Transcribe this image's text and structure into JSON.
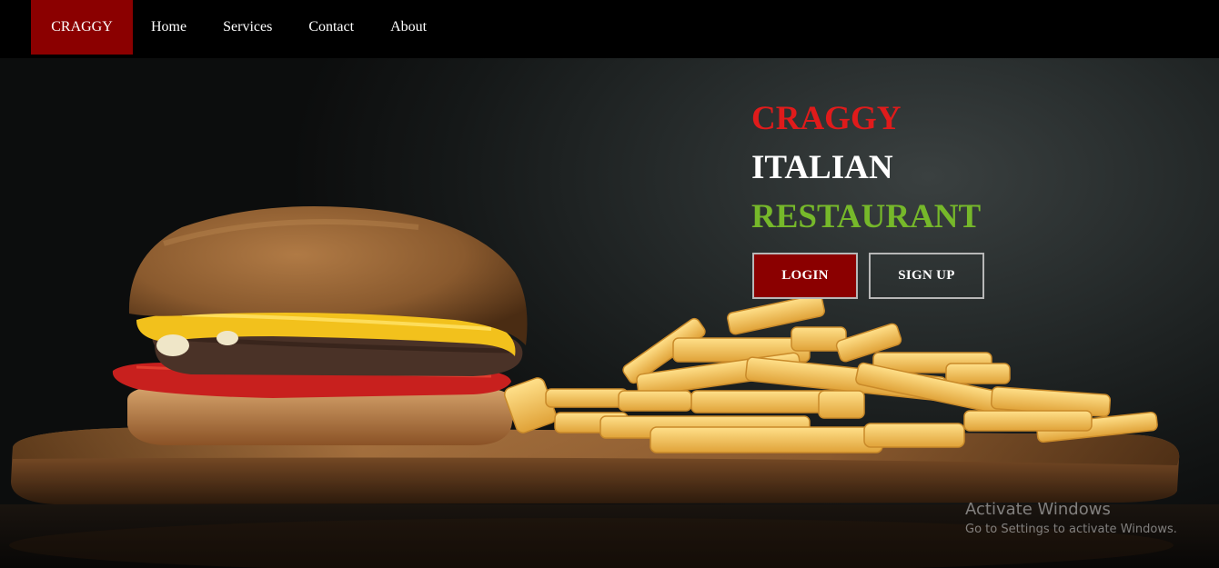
{
  "nav": {
    "brand": "CRAGGY",
    "links": [
      "Home",
      "Services",
      "Contact",
      "About"
    ]
  },
  "hero": {
    "headline": [
      "CRAGGY",
      "ITALIAN",
      "RESTAURANT"
    ],
    "headline_colors": [
      "#e01b1b",
      "#ffffff",
      "#76b82a"
    ],
    "login_label": "LOGIN",
    "signup_label": "SIGN UP",
    "image_description_icon": "burger-fries-photo"
  },
  "watermark": {
    "title": "Activate Windows",
    "subtitle": "Go to Settings to activate Windows."
  },
  "colors": {
    "brand_bg": "#8b0000",
    "nav_bg": "#000000"
  }
}
